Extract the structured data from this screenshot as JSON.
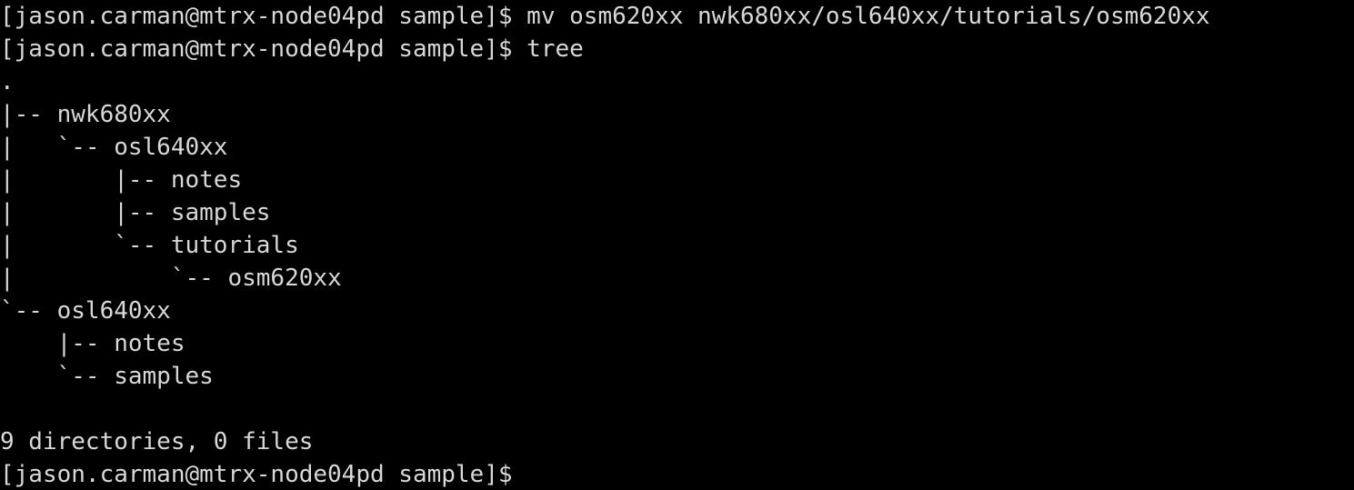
{
  "terminal": {
    "window_kind": "shell-terminal",
    "background_color": "#000000",
    "foreground_color": "#d8d8d8",
    "columns": 86,
    "rows": 15,
    "prompt": "[jason.carman@mtrx-node04pd sample]$",
    "user": "jason.carman",
    "host": "mtrx-node04pd",
    "cwd_basename": "sample",
    "lines": [
      "[jason.carman@mtrx-node04pd sample]$ mv osm620xx nwk680xx/osl640xx/tutorials/osm620xx",
      "[jason.carman@mtrx-node04pd sample]$ tree",
      ".",
      "|-- nwk680xx",
      "|   `-- osl640xx",
      "|       |-- notes",
      "|       |-- samples",
      "|       `-- tutorials",
      "|           `-- osm620xx",
      "`-- osl640xx",
      "    |-- notes",
      "    `-- samples",
      "",
      "9 directories, 0 files",
      "[jason.carman@mtrx-node04pd sample]$"
    ],
    "commands": [
      {
        "index": 0,
        "text": "mv osm620xx nwk680xx/osl640xx/tutorials/osm620xx",
        "program": "mv",
        "args": [
          "osm620xx",
          "nwk680xx/osl640xx/tutorials/osm620xx"
        ]
      },
      {
        "index": 1,
        "text": "tree",
        "program": "tree",
        "args": []
      }
    ],
    "tree": {
      "root": ".",
      "entries": [
        {
          "depth": 0,
          "connector": "|--",
          "name": "nwk680xx"
        },
        {
          "depth": 1,
          "connector": "`--",
          "name": "osl640xx"
        },
        {
          "depth": 2,
          "connector": "|--",
          "name": "notes"
        },
        {
          "depth": 2,
          "connector": "|--",
          "name": "samples"
        },
        {
          "depth": 2,
          "connector": "`--",
          "name": "tutorials"
        },
        {
          "depth": 3,
          "connector": "`--",
          "name": "osm620xx"
        },
        {
          "depth": 0,
          "connector": "`--",
          "name": "osl640xx"
        },
        {
          "depth": 1,
          "connector": "|--",
          "name": "notes"
        },
        {
          "depth": 1,
          "connector": "`--",
          "name": "samples"
        }
      ],
      "summary": "9 directories, 0 files",
      "directory_count": 9,
      "file_count": 0
    }
  }
}
